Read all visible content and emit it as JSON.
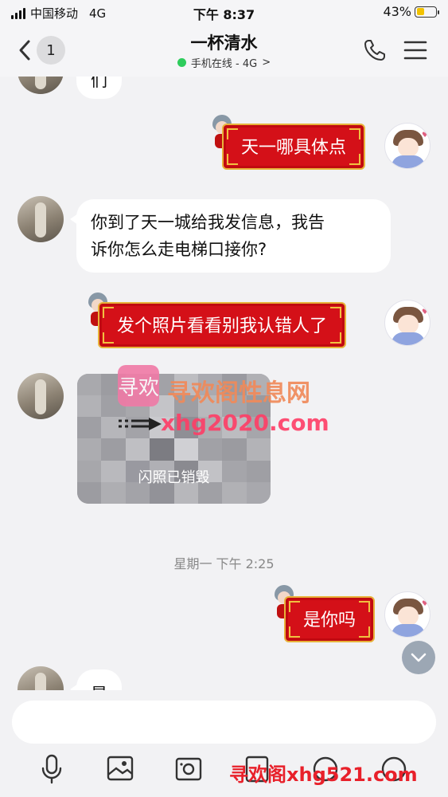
{
  "status_bar": {
    "carrier": "中国移动",
    "network": "4G",
    "time": "下午 8:37",
    "battery": "43%"
  },
  "nav": {
    "back_badge": "1",
    "title": "一杯清水",
    "subtitle": "手机在线 - 4G",
    "chevron": ">"
  },
  "messages": [
    {
      "side": "left",
      "text": "们"
    },
    {
      "side": "right",
      "text": "天一哪具体点"
    },
    {
      "side": "left",
      "line1": "你到了天一城给我发信息，我告",
      "line2": "诉你怎么走电梯口接你?"
    },
    {
      "side": "right",
      "text": "发个照片看看别我认错人了"
    },
    {
      "side": "left",
      "type": "flash_photo",
      "label": "闪照已销毁"
    },
    {
      "side": "right",
      "text": "是你吗"
    },
    {
      "side": "left",
      "text": "是"
    }
  ],
  "timestamp": "星期一 下午 2:25",
  "watermarks": {
    "logo": "寻欢",
    "title": "寻欢阁性息网",
    "url": "xhg2020.com",
    "bottom": "寻欢阁xhg521.com"
  },
  "colors": {
    "red_bubble": "#d41018",
    "online_dot": "#2ecc5c",
    "background": "#f2f2f4"
  },
  "icons": [
    "back-icon",
    "phone-icon",
    "menu-icon",
    "mic-icon",
    "image-icon",
    "camera-icon",
    "scroll-down-icon"
  ]
}
